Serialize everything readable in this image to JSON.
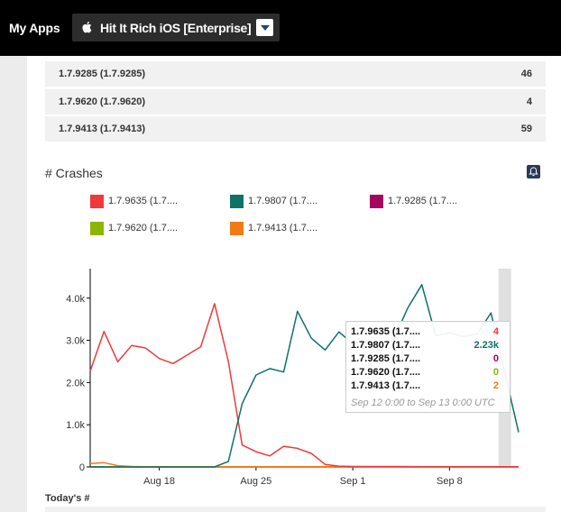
{
  "header": {
    "my_apps_label": "My Apps",
    "app_name": "Hit It Rich iOS [Enterprise]"
  },
  "version_rows": [
    {
      "name": "1.7.9285 (1.7.9285)",
      "count": "46"
    },
    {
      "name": "1.7.9620 (1.7.9620)",
      "count": "4"
    },
    {
      "name": "1.7.9413 (1.7.9413)",
      "count": "59"
    }
  ],
  "crashes": {
    "title": "# Crashes",
    "legend": [
      {
        "label": "1.7.9635 (1.7....",
        "color": "#ef3a3a"
      },
      {
        "label": "1.7.9807 (1.7....",
        "color": "#0e7365"
      },
      {
        "label": "1.7.9285 (1.7....",
        "color": "#a3055f"
      },
      {
        "label": "1.7.9620 (1.7....",
        "color": "#8db500"
      },
      {
        "label": "1.7.9413 (1.7....",
        "color": "#f27a14"
      }
    ],
    "tooltip": {
      "rows": [
        {
          "name": "1.7.9635 (1.7....",
          "value": "4",
          "color": "#ef3a3a"
        },
        {
          "name": "1.7.9807 (1.7....",
          "value": "2.23k",
          "color": "#0e7365"
        },
        {
          "name": "1.7.9285 (1.7....",
          "value": "0",
          "color": "#a3055f"
        },
        {
          "name": "1.7.9620 (1.7....",
          "value": "0",
          "color": "#8db500"
        },
        {
          "name": "1.7.9413 (1.7....",
          "value": "2",
          "color": "#f27a14"
        }
      ],
      "range": "Sep 12 0:00 to Sep 13 0:00 UTC"
    }
  },
  "chart_data": {
    "type": "line",
    "x": [
      "Aug 13",
      "Aug 14",
      "Aug 15",
      "Aug 16",
      "Aug 17",
      "Aug 18",
      "Aug 19",
      "Aug 20",
      "Aug 21",
      "Aug 22",
      "Aug 23",
      "Aug 24",
      "Aug 25",
      "Aug 26",
      "Aug 27",
      "Aug 28",
      "Aug 29",
      "Aug 30",
      "Aug 31",
      "Sep 1",
      "Sep 2",
      "Sep 3",
      "Sep 4",
      "Sep 5",
      "Sep 6",
      "Sep 7",
      "Sep 8",
      "Sep 9",
      "Sep 10",
      "Sep 11",
      "Sep 12",
      "Sep 13"
    ],
    "x_ticks": [
      "Aug 18",
      "Aug 25",
      "Sep 1",
      "Sep 8"
    ],
    "y_ticks": [
      "0",
      "1.0k",
      "2.0k",
      "3.0k",
      "4.0k"
    ],
    "ylim": [
      0,
      4700
    ],
    "highlight_index": 30,
    "series": [
      {
        "name": "1.7.9635 (1.7....",
        "color": "#ef3a3a",
        "values": [
          2270,
          3210,
          2490,
          2880,
          2820,
          2570,
          2450,
          2650,
          2850,
          3870,
          2500,
          520,
          360,
          260,
          490,
          440,
          320,
          60,
          20,
          10,
          10,
          10,
          10,
          8,
          6,
          5,
          4,
          4,
          4,
          4,
          4,
          4
        ]
      },
      {
        "name": "1.7.9807 (1.7....",
        "color": "#0e7365",
        "values": [
          0,
          0,
          0,
          0,
          0,
          0,
          0,
          0,
          0,
          0,
          130,
          1500,
          2180,
          2330,
          2250,
          3690,
          3050,
          2770,
          3200,
          2920,
          3010,
          2750,
          3060,
          3780,
          4320,
          3110,
          3180,
          3090,
          3150,
          3650,
          2230,
          820
        ]
      },
      {
        "name": "1.7.9285 (1.7....",
        "color": "#a3055f",
        "values": [
          0,
          0,
          0,
          0,
          0,
          0,
          0,
          0,
          0,
          0,
          0,
          0,
          0,
          0,
          0,
          0,
          0,
          0,
          0,
          0,
          0,
          0,
          0,
          0,
          0,
          0,
          0,
          0,
          0,
          0,
          0,
          0
        ]
      },
      {
        "name": "1.7.9620 (1.7....",
        "color": "#8db500",
        "values": [
          0,
          0,
          0,
          0,
          0,
          0,
          0,
          0,
          0,
          0,
          0,
          0,
          0,
          0,
          0,
          0,
          0,
          0,
          0,
          0,
          0,
          0,
          0,
          0,
          0,
          0,
          0,
          0,
          0,
          0,
          0,
          0
        ]
      },
      {
        "name": "1.7.9413 (1.7....",
        "color": "#f27a14",
        "values": [
          80,
          100,
          30,
          10,
          5,
          5,
          5,
          5,
          5,
          5,
          5,
          5,
          5,
          5,
          5,
          5,
          5,
          5,
          5,
          5,
          5,
          5,
          5,
          5,
          5,
          5,
          5,
          5,
          5,
          5,
          2,
          2
        ]
      }
    ]
  },
  "footer": {
    "todays_label": "Today's #"
  }
}
